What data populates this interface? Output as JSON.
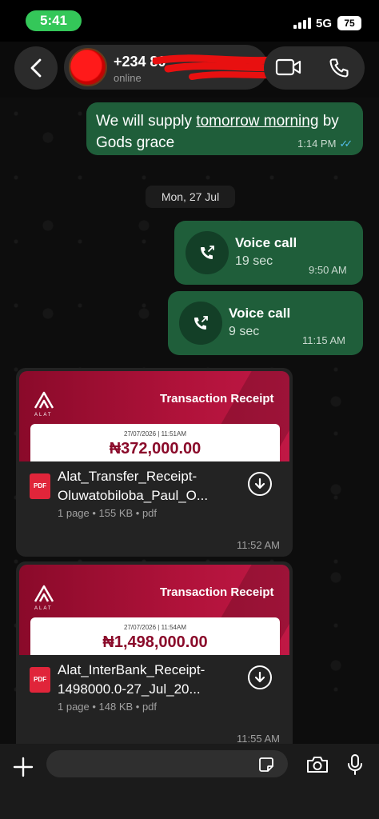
{
  "status_bar": {
    "time": "5:41",
    "network": "5G",
    "battery": "75"
  },
  "header": {
    "contact_name": "+234 80",
    "contact_status": "online"
  },
  "messages": {
    "text_message": {
      "text_before": "We will supply ",
      "text_link": "tomorrow morning",
      "text_after": " by Gods grace",
      "time": "1:14 PM"
    },
    "date_separator": "Mon, 27 Jul",
    "calls": [
      {
        "title": "Voice call",
        "duration": "19 sec",
        "time": "9:50 AM"
      },
      {
        "title": "Voice call",
        "duration": "9 sec",
        "time": "11:15 AM"
      }
    ],
    "documents": [
      {
        "preview_title": "Transaction Receipt",
        "preview_brand": "ALAT",
        "preview_date": "27/07/2026 | 11:51AM",
        "preview_amount": "₦372,000.00",
        "file_icon": "PDF",
        "file_name": "Alat_Transfer_Receipt-Oluwatobiloba_Paul_O...",
        "file_info": "1 page • 155 KB • pdf",
        "time": "11:52 AM"
      },
      {
        "preview_title": "Transaction Receipt",
        "preview_brand": "ALAT",
        "preview_date": "27/07/2026 | 11:54AM",
        "preview_amount": "₦1,498,000.00",
        "file_icon": "PDF",
        "file_name": "Alat_InterBank_Receipt-1498000.0-27_Jul_20...",
        "file_info": "1 page • 148 KB • pdf",
        "time": "11:55 AM"
      }
    ]
  },
  "input_bar": {
    "placeholder": ""
  },
  "colors": {
    "outgoing_bubble": "#1f5e3a",
    "incoming_bubble": "#232323",
    "read_ticks": "#53bdeb",
    "status_pill": "#34c759",
    "receipt_red": "#b0123a"
  },
  "icons": [
    "back-icon",
    "video-call-icon",
    "phone-icon",
    "voice-call-icon",
    "pdf-icon",
    "download-icon",
    "plus-icon",
    "sticker-icon",
    "camera-icon",
    "mic-icon",
    "alat-logo"
  ]
}
